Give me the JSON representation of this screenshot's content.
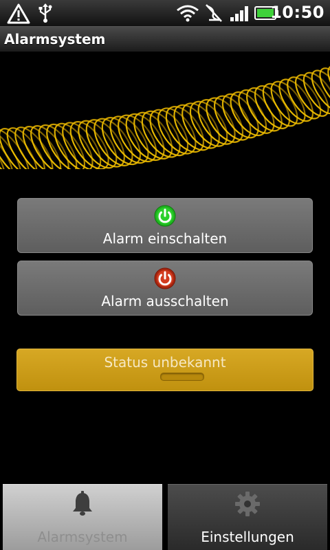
{
  "statusbar": {
    "time": "10:50",
    "icons": [
      "warning-icon",
      "usb-icon",
      "wifi-icon",
      "vibrate-icon",
      "signal-icon",
      "battery-icon"
    ]
  },
  "titlebar": {
    "title": "Alarmsystem"
  },
  "buttons": {
    "arm_label": "Alarm einschalten",
    "disarm_label": "Alarm ausschalten"
  },
  "status": {
    "label": "Status unbekannt"
  },
  "tabs": [
    {
      "label": "Alarmsystem",
      "icon": "bell-icon",
      "active": true
    },
    {
      "label": "Einstellungen",
      "icon": "gear-icon",
      "active": false
    }
  ],
  "colors": {
    "arm_icon": "#1fb41f",
    "disarm_icon": "#c8321c",
    "status_bar": "#cfa01c",
    "banner_coil": "#f2c200"
  }
}
